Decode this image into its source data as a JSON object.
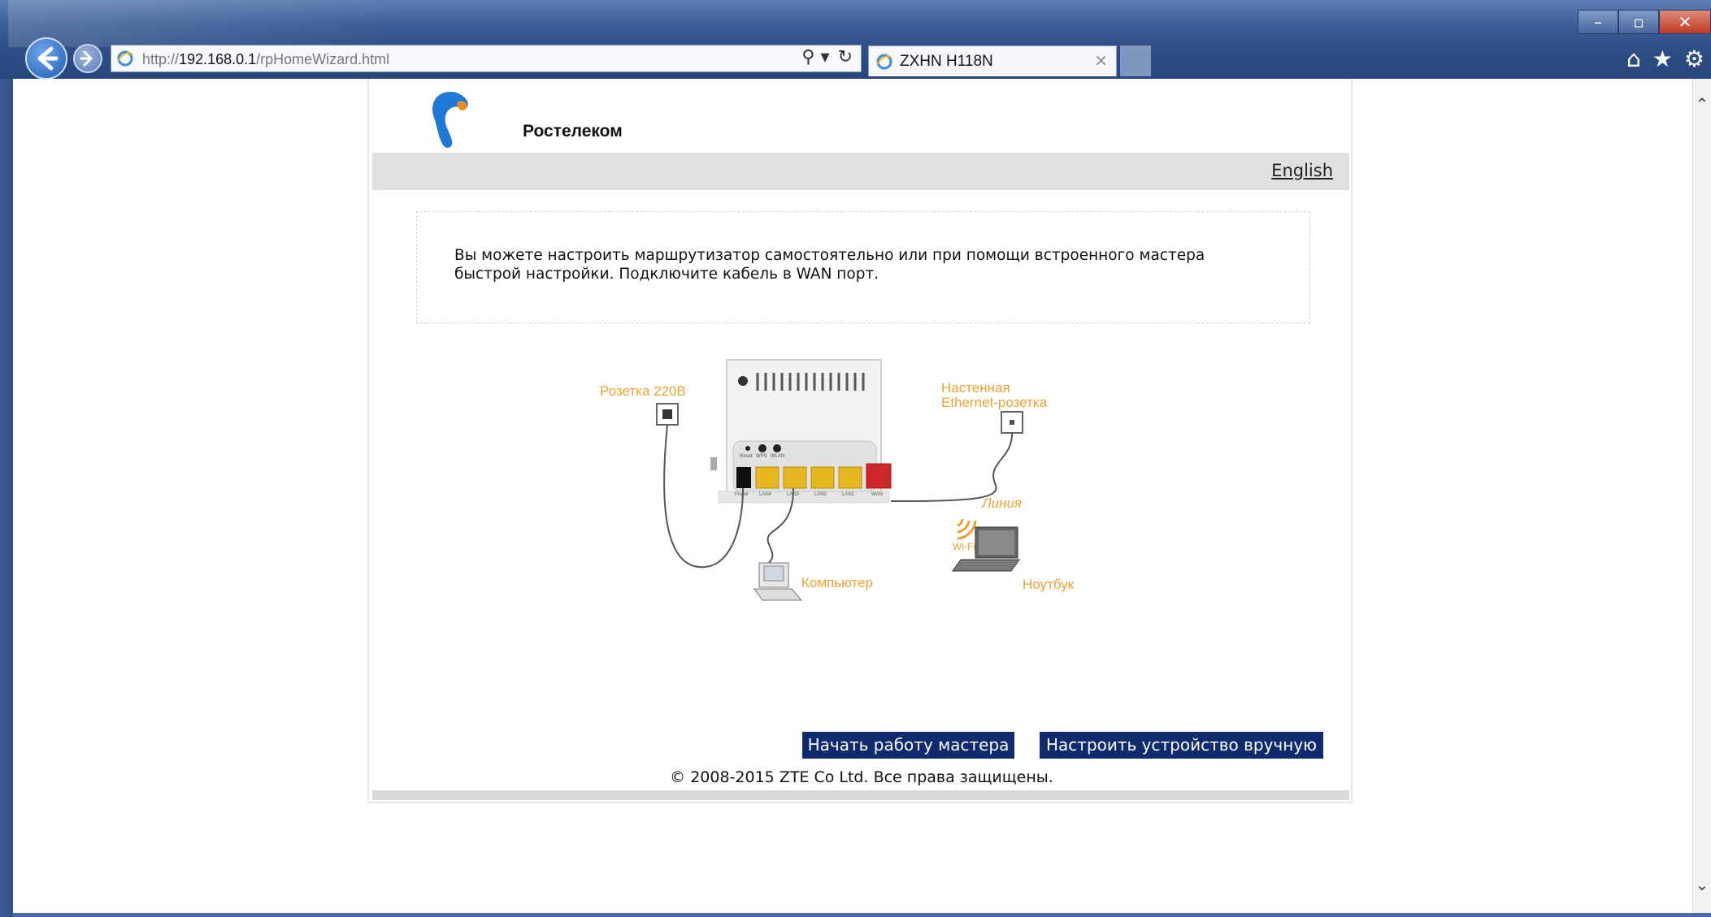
{
  "browser": {
    "url_prefix": "http://",
    "url_host": "192.168.0.1",
    "url_path": "/rpHomeWizard.html",
    "tab_title": "ZXHN H118N",
    "tab_close": "×",
    "win_minimize": "–",
    "win_maximize": "▫",
    "win_close": "✕",
    "search_tool": "⚲ ▾",
    "refresh_tool": "↻",
    "home_icon": "⌂",
    "favorites_icon": "★",
    "tools_icon": "⚙",
    "scroll_up": "⌃",
    "scroll_down": "⌄"
  },
  "page": {
    "brand": "Ростелеком",
    "language_link": "English",
    "intro_text": "Вы можете настроить маршрутизатор самостоятельно или при помощи встроенного мастера быстрой настройки. Подключите кабель в WAN порт.",
    "diagram": {
      "socket_label": "Розетка 220В",
      "wall_label_line1": "Настенная",
      "wall_label_line2": "Ethernet-розетка",
      "line_label": "Линия",
      "computer_label": "Компьютер",
      "laptop_label": "Ноутбук",
      "wifi_label": "Wi-Fi",
      "port_labels": [
        "Power",
        "LAN4",
        "LAN3",
        "LAN2",
        "LAN1",
        "WAN"
      ],
      "button_labels": [
        "Reset",
        "WPS",
        "WLAN"
      ]
    },
    "wizard_button": "Начать работу мастера",
    "manual_button": "Настроить устройство вручную",
    "copyright": "© 2008-2015 ZTE Co Ltd. Все права защищены."
  },
  "colors": {
    "accent_orange": "#f0a030",
    "button_navy": "#0f2b6e",
    "brand_blue": "#1e7ad6",
    "brand_orange": "#f28c1a"
  }
}
